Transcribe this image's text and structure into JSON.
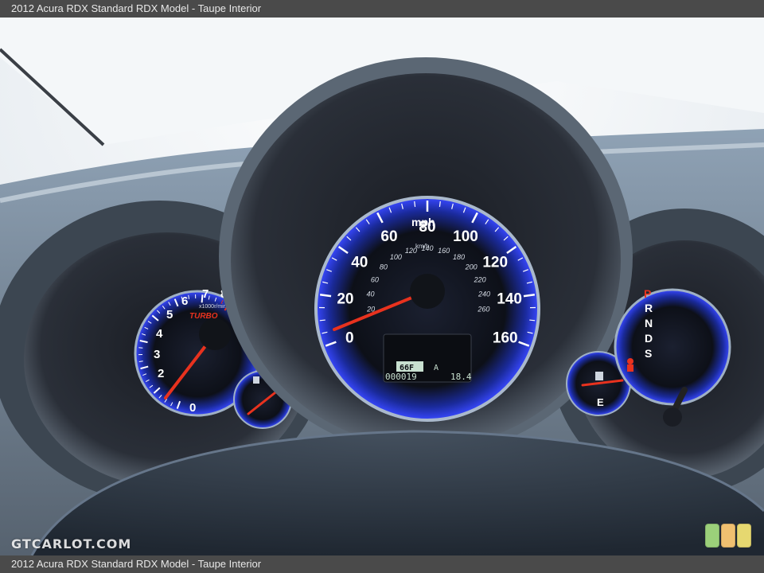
{
  "caption": {
    "top": "2012 Acura RDX Standard RDX Model - Taupe Interior",
    "bottom": "2012 Acura RDX Standard RDX Model - Taupe Interior"
  },
  "watermark": "GTCARLOT.COM",
  "speedometer": {
    "unit_main": "mph",
    "unit_sub": "km/h",
    "mph_ticks": [
      "0",
      "20",
      "40",
      "60",
      "80",
      "100",
      "120",
      "140",
      "160"
    ],
    "kmh_ticks": [
      "20",
      "40",
      "60",
      "80",
      "100",
      "120",
      "140",
      "160",
      "180",
      "200",
      "220",
      "240",
      "260"
    ],
    "needle_value": 0
  },
  "tachometer": {
    "ticks": [
      "0",
      "2",
      "3",
      "4",
      "5",
      "6",
      "7",
      "8"
    ],
    "unit": "x1000r/min",
    "turbo_label": "TURBO"
  },
  "odometer": {
    "temp": "66F",
    "trip_mode": "A",
    "odometer": "000019",
    "trip": "18.4"
  },
  "fuel_gauge": {
    "empty_label": "E"
  },
  "gear_indicator": {
    "gears": [
      "P",
      "R",
      "N",
      "D",
      "S"
    ],
    "active": "P"
  },
  "colors": {
    "gauge_blue": "#2a3cff",
    "needle_red": "#e8321e",
    "dash_gray": "#5e6b7a",
    "display_green": "#c8e0d0"
  },
  "icons": {
    "fuel": "fuel-pump-icon",
    "seatbelt": "seatbelt-warning-icon",
    "badge": "traffic-light-badge-icon"
  }
}
